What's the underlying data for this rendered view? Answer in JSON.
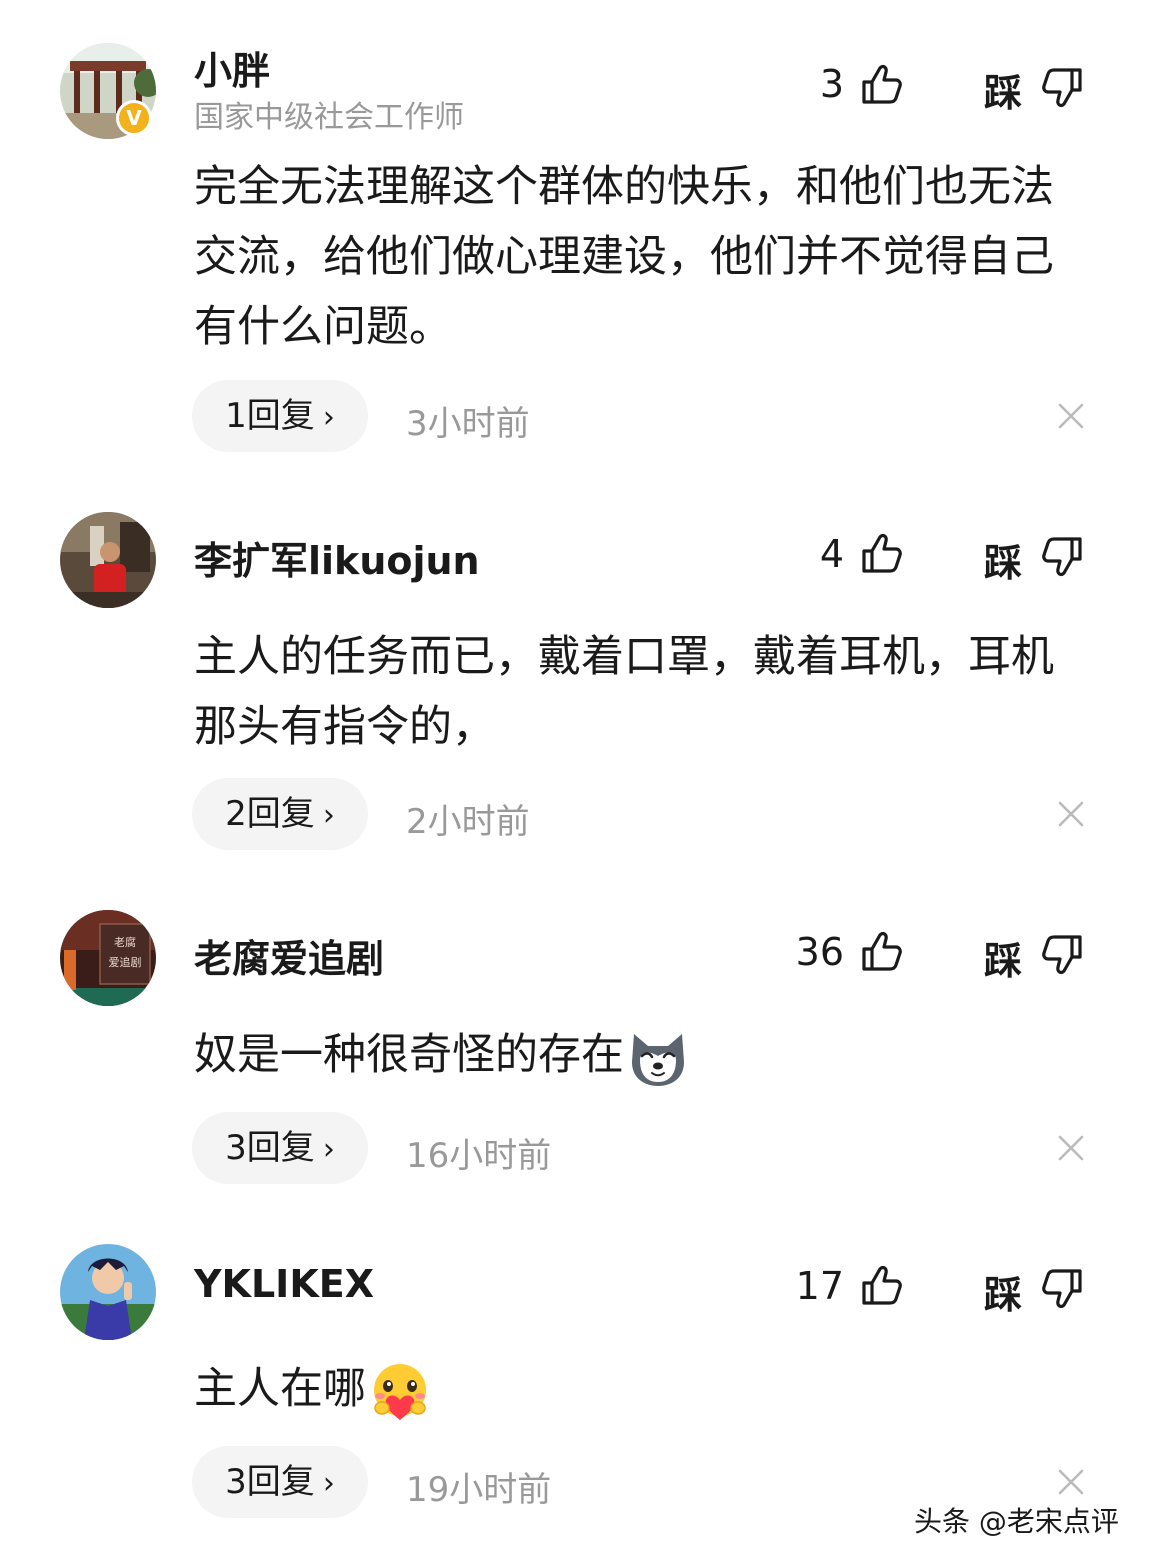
{
  "comments": [
    {
      "username": "小胖",
      "user_title": "国家中级社会工作师",
      "verified_badge": "V",
      "like_count": "3",
      "dislike_label": "踩",
      "text": "完全无法理解这个群体的快乐，和他们也无法交流，给他们做心理建设，他们并不觉得自己有什么问题。",
      "replies": "1回复",
      "time": "3小时前"
    },
    {
      "username": "李扩军likuojun",
      "like_count": "4",
      "dislike_label": "踩",
      "text": "主人的任务而已，戴着口罩，戴着耳机，耳机那头有指令的，",
      "replies": "2回复",
      "time": "2小时前"
    },
    {
      "username": "老腐爱追剧",
      "avatar_text_1": "老腐",
      "avatar_text_2": "爱追剧",
      "like_count": "36",
      "dislike_label": "踩",
      "text": "奴是一种很奇怪的存在",
      "emoji": "husky-emoji",
      "replies": "3回复",
      "time": "16小时前"
    },
    {
      "username": "YKLIKEX",
      "like_count": "17",
      "dislike_label": "踩",
      "text": "主人在哪",
      "emoji": "love-heart-emoji",
      "replies": "3回复",
      "time": "19小时前"
    }
  ],
  "reply_chevron": "›",
  "watermark": "头条 @老宋点评",
  "colors": {
    "text": "#1a1a1a",
    "muted": "#999999",
    "pill_bg": "#f4f4f4",
    "badge": "#f3b21b"
  }
}
